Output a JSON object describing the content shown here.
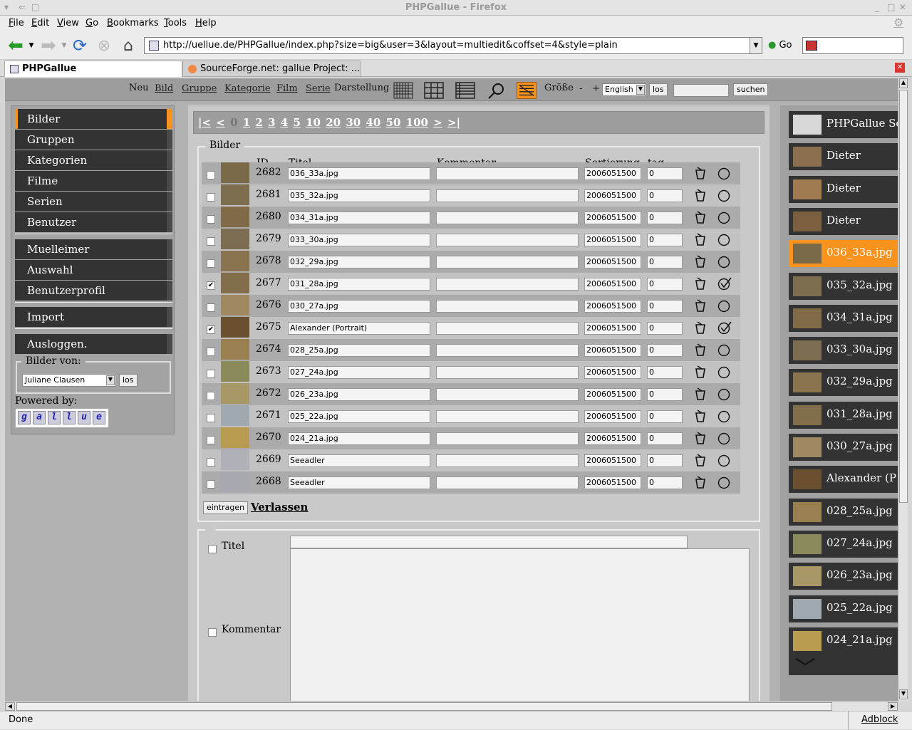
{
  "window": {
    "title": "PHPGallue - Firefox"
  },
  "menu": [
    "File",
    "Edit",
    "View",
    "Go",
    "Bookmarks",
    "Tools",
    "Help"
  ],
  "nav": {
    "url": "http://uellue.de/PHPGallue/index.php?size=big&user=3&layout=multiedit&coffset=4&style=plain",
    "go": "Go"
  },
  "tabs": [
    {
      "label": "PHPGallue"
    },
    {
      "label": "SourceForge.net: gallue Project: ..."
    }
  ],
  "toolbar": {
    "neu": "Neu",
    "bild": "Bild",
    "gruppe": "Gruppe",
    "kategorie": "Kategorie",
    "film": "Film",
    "serie": "Serie",
    "darstellung": "Darstellung",
    "groesse": "Größe",
    "minus": "-",
    "plus": "+",
    "language": "English",
    "los": "los",
    "suchen": "suchen"
  },
  "sidebar": {
    "items": [
      "Bilder",
      "Gruppen",
      "Kategorien",
      "Filme",
      "Serien",
      "Benutzer"
    ],
    "items2": [
      "Muelleimer",
      "Auswahl",
      "Benutzerprofil"
    ],
    "import": "Import",
    "logout": "Ausloggen.",
    "bilder_von": "Bilder von:",
    "user_select": "Juliane Clausen",
    "los": "los",
    "powered_by": "Powered by:",
    "logo_letters": [
      "g",
      "a",
      "l",
      "l",
      "u",
      "e"
    ]
  },
  "pager": [
    "|<",
    "<",
    "0",
    "1",
    "2",
    "3",
    "4",
    "5",
    "10",
    "20",
    "30",
    "40",
    "50",
    "100",
    ">",
    ">|"
  ],
  "images_legend": "Bilder",
  "columns": {
    "id": "ID",
    "titel": "Titel",
    "kommentar": "Kommentar",
    "sortierung": "Sortierung",
    "tag": "tag"
  },
  "rows": [
    {
      "id": "2682",
      "title": "036_33a.jpg",
      "comment": "",
      "sort": "2006051500",
      "tag": "0",
      "checked": "",
      "thumb_color": "#7a6a4a"
    },
    {
      "id": "2681",
      "title": "035_32a.jpg",
      "comment": "",
      "sort": "2006051500",
      "tag": "0",
      "checked": "",
      "thumb_color": "#7e6e50"
    },
    {
      "id": "2680",
      "title": "034_31a.jpg",
      "comment": "",
      "sort": "2006051500",
      "tag": "0",
      "checked": "",
      "thumb_color": "#806a48"
    },
    {
      "id": "2679",
      "title": "033_30a.jpg",
      "comment": "",
      "sort": "2006051500",
      "tag": "0",
      "checked": "",
      "thumb_color": "#7c6c52"
    },
    {
      "id": "2678",
      "title": "032_29a.jpg",
      "comment": "",
      "sort": "2006051500",
      "tag": "0",
      "checked": "",
      "thumb_color": "#8a7450"
    },
    {
      "id": "2677",
      "title": "031_28a.jpg",
      "comment": "",
      "sort": "2006051500",
      "tag": "0",
      "checked": "✔",
      "thumb_color": "#836e4c"
    },
    {
      "id": "2676",
      "title": "030_27a.jpg",
      "comment": "",
      "sort": "2006051500",
      "tag": "0",
      "checked": "",
      "thumb_color": "#a08860"
    },
    {
      "id": "2675",
      "title": "Alexander (Portrait)",
      "comment": "",
      "sort": "2006051500",
      "tag": "0",
      "checked": "✔",
      "thumb_color": "#6a5030"
    },
    {
      "id": "2674",
      "title": "028_25a.jpg",
      "comment": "",
      "sort": "2006051500",
      "tag": "0",
      "checked": "",
      "thumb_color": "#9a8050"
    },
    {
      "id": "2673",
      "title": "027_24a.jpg",
      "comment": "",
      "sort": "2006051500",
      "tag": "0",
      "checked": "",
      "thumb_color": "#8a8a5a"
    },
    {
      "id": "2672",
      "title": "026_23a.jpg",
      "comment": "",
      "sort": "2006051500",
      "tag": "0",
      "checked": "",
      "thumb_color": "#a89868"
    },
    {
      "id": "2671",
      "title": "025_22a.jpg",
      "comment": "",
      "sort": "2006051500",
      "tag": "0",
      "checked": "",
      "thumb_color": "#a0a8b0"
    },
    {
      "id": "2670",
      "title": "024_21a.jpg",
      "comment": "",
      "sort": "2006051500",
      "tag": "0",
      "checked": "",
      "thumb_color": "#b89a50"
    },
    {
      "id": "2669",
      "title": "Seeadler",
      "comment": "",
      "sort": "2006051500",
      "tag": "0",
      "checked": "",
      "thumb_color": "#b0b0b8"
    },
    {
      "id": "2668",
      "title": "Seeadler",
      "comment": "",
      "sort": "2006051500",
      "tag": "0",
      "checked": "",
      "thumb_color": "#a8a8b0"
    }
  ],
  "actions": {
    "eintragen": "eintragen",
    "verlassen": "Verlassen"
  },
  "bulk": {
    "titel_label": "Titel",
    "kommentar_label": "Kommentar"
  },
  "right_items": [
    {
      "label": "PHPGallue Sc",
      "thumb_color": "#d8d8d8"
    },
    {
      "label": "Dieter",
      "thumb_color": "#8a7050"
    },
    {
      "label": "Dieter",
      "thumb_color": "#a07a50"
    },
    {
      "label": "Dieter",
      "thumb_color": "#7a6040"
    },
    {
      "label": "036_33a.jpg",
      "thumb_color": "#7a6a4a"
    },
    {
      "label": "035_32a.jpg",
      "thumb_color": "#7e6e50"
    },
    {
      "label": "034_31a.jpg",
      "thumb_color": "#806a48"
    },
    {
      "label": "033_30a.jpg",
      "thumb_color": "#7c6c52"
    },
    {
      "label": "032_29a.jpg",
      "thumb_color": "#8a7450"
    },
    {
      "label": "031_28a.jpg",
      "thumb_color": "#836e4c"
    },
    {
      "label": "030_27a.jpg",
      "thumb_color": "#a08860"
    },
    {
      "label": "Alexander (P",
      "thumb_color": "#6a5030"
    },
    {
      "label": "028_25a.jpg",
      "thumb_color": "#9a8050"
    },
    {
      "label": "027_24a.jpg",
      "thumb_color": "#8a8a5a"
    },
    {
      "label": "026_23a.jpg",
      "thumb_color": "#a89868"
    },
    {
      "label": "025_22a.jpg",
      "thumb_color": "#a0a8b0"
    },
    {
      "label": "024_21a.jpg",
      "thumb_color": "#b89a50"
    }
  ],
  "status": {
    "text": "Done",
    "adblock": "Adblock"
  },
  "colors": {
    "accent": "#f7931e",
    "menu_bg": "#333333"
  }
}
